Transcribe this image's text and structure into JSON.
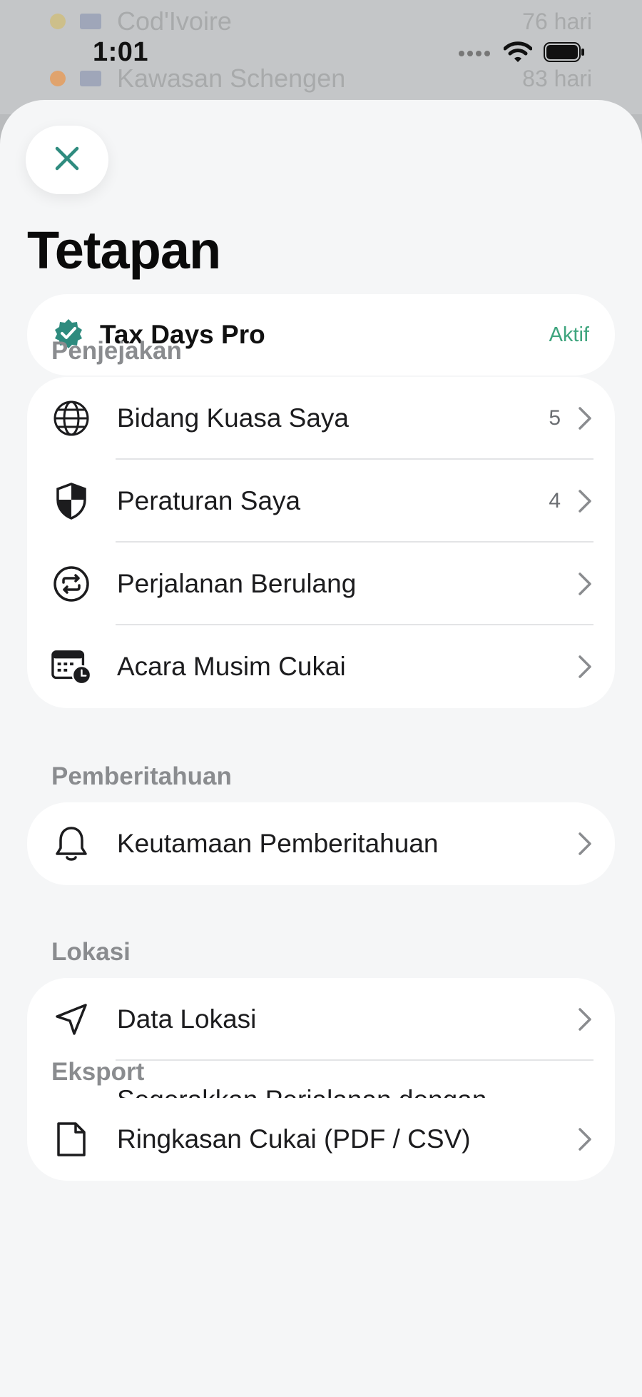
{
  "background": {
    "rows": [
      {
        "name": "Cod'Ivoire",
        "value": "76 hari"
      },
      {
        "name": "Kawasan Schengen",
        "value": "83 hari"
      }
    ]
  },
  "status_bar": {
    "time": "1:01"
  },
  "sheet": {
    "title": "Tetapan",
    "pro": {
      "label": "Tax Days Pro",
      "state": "Aktif"
    },
    "sections": {
      "tracking": {
        "header": "Penjejakan",
        "items": [
          {
            "label": "Bidang Kuasa Saya",
            "count": "5",
            "icon": "globe-icon"
          },
          {
            "label": "Peraturan Saya",
            "count": "4",
            "icon": "shield-icon"
          },
          {
            "label": "Perjalanan Berulang",
            "count": "",
            "icon": "repeat-icon"
          },
          {
            "label": "Acara Musim Cukai",
            "count": "",
            "icon": "calendar-clock-icon"
          }
        ]
      },
      "notifications": {
        "header": "Pemberitahuan",
        "items": [
          {
            "label": "Keutamaan Pemberitahuan",
            "icon": "bell-icon"
          }
        ]
      },
      "location": {
        "header": "Lokasi",
        "items": [
          {
            "label": "Data Lokasi",
            "icon": "location-arrow-icon"
          },
          {
            "label": "Segerakkan Perjalanan dengan Data Lokasi",
            "icon": "sync-icon"
          }
        ]
      },
      "export": {
        "header": "Eksport",
        "items": [
          {
            "label": "Ringkasan Cukai (PDF / CSV)",
            "icon": "document-icon"
          }
        ]
      }
    }
  },
  "colors": {
    "accent": "#2e8b7e",
    "active_green": "#3fa57e"
  }
}
